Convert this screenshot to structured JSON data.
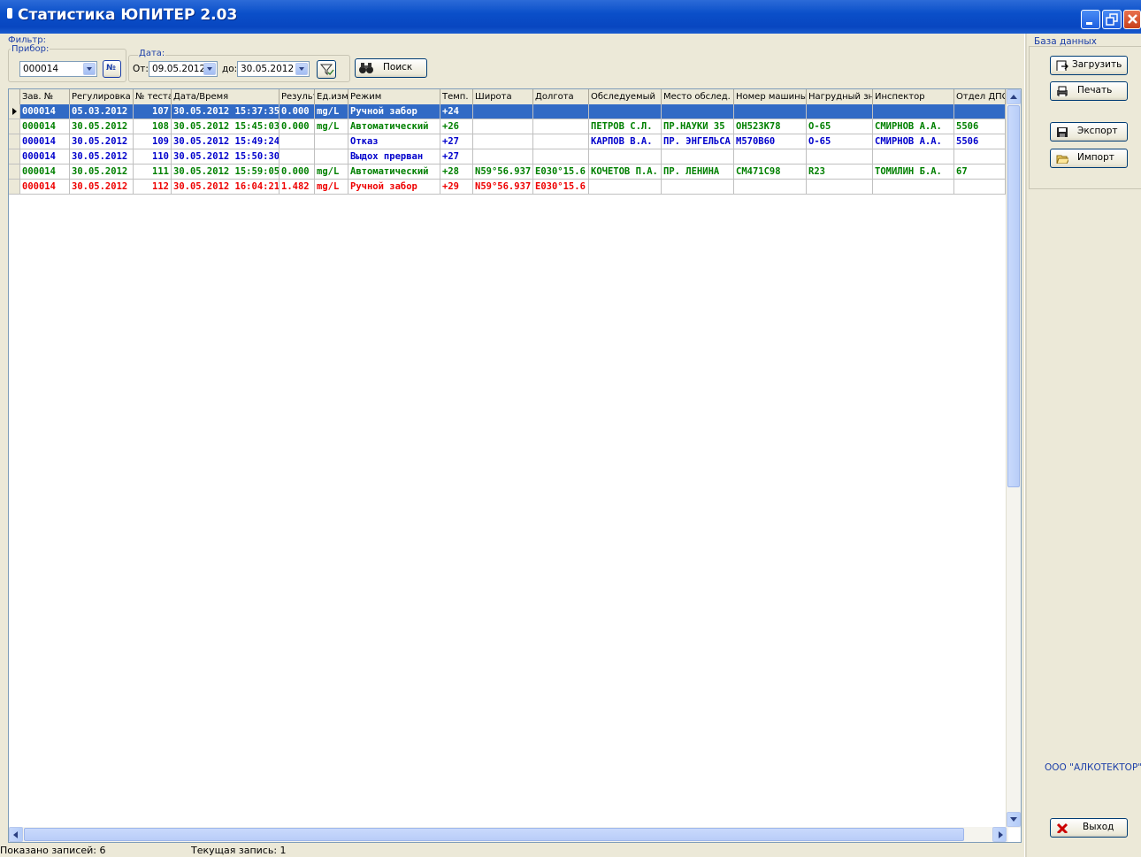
{
  "window": {
    "title": "Статистика ЮПИТЕР 2.03"
  },
  "filter": {
    "group_label": "Фильтр:",
    "device_label": "Прибор:",
    "device_value": "000014",
    "number_button": "№",
    "date_label": "Дата:",
    "from_label": "От:",
    "from_value": "09.05.2012",
    "to_label": "до:",
    "to_value": "30.05.2012",
    "search_label": "Поиск"
  },
  "table": {
    "columns": [
      "Зав. №",
      "Регулировка",
      "№ теста",
      "Дата/Время",
      "Результ",
      "Ед.изм",
      "Режим",
      "Темп.",
      "Широта",
      "Долгота",
      "Обследуемый",
      "Место обслед.",
      "Номер машины",
      "Нагрудный знак",
      "Инспектор",
      "Отдел ДПС"
    ],
    "rows": [
      {
        "color": "#ffffff",
        "cells": [
          "000014",
          "05.03.2012",
          "107",
          "30.05.2012 15:37:35",
          "0.000",
          "mg/L",
          "Ручной забор",
          "+24",
          "",
          "",
          "",
          "",
          "",
          "",
          "",
          ""
        ]
      },
      {
        "color": "#008000",
        "cells": [
          "000014",
          "30.05.2012",
          "108",
          "30.05.2012 15:45:03",
          "0.000",
          "mg/L",
          "Автоматический",
          "+26",
          "",
          "",
          "ПЕТРОВ С.Л.",
          "ПР.НАУКИ 35",
          "ОН523К78",
          "О-65",
          "СМИРНОВ А.А.",
          "5506"
        ]
      },
      {
        "color": "#0000cc",
        "cells": [
          "000014",
          "30.05.2012",
          "109",
          "30.05.2012 15:49:24",
          "",
          "",
          "Отказ",
          "+27",
          "",
          "",
          "КАРПОВ В.А.",
          "ПР. ЭНГЕЛЬСА",
          "М570В60",
          "О-65",
          "СМИРНОВ А.А.",
          "5506"
        ]
      },
      {
        "color": "#0000cc",
        "cells": [
          "000014",
          "30.05.2012",
          "110",
          "30.05.2012 15:50:30",
          "",
          "",
          "Выдох прерван",
          "+27",
          "",
          "",
          "",
          "",
          "",
          "",
          "",
          ""
        ]
      },
      {
        "color": "#008000",
        "cells": [
          "000014",
          "30.05.2012",
          "111",
          "30.05.2012 15:59:05",
          "0.000",
          "mg/L",
          "Автоматический",
          "+28",
          "N59°56.937",
          "E030°15.6",
          "КОЧЕТОВ П.А.",
          "ПР. ЛЕНИНА",
          "СМ471С98",
          "R23",
          "ТОМИЛИН Б.А.",
          "67"
        ]
      },
      {
        "color": "#ee0000",
        "cells": [
          "000014",
          "30.05.2012",
          "112",
          "30.05.2012 16:04:21",
          "1.482",
          "mg/L",
          "Ручной забор",
          "+29",
          "N59°56.937",
          "E030°15.6",
          "",
          "",
          "",
          "",
          "",
          ""
        ]
      }
    ]
  },
  "sidebar": {
    "group_label": "База данных",
    "load_label": "Загрузить",
    "print_label": "Печать",
    "export_label": "Экспорт",
    "import_label": "Импорт",
    "company": "ООО \"АЛКОТЕКТОР\"",
    "exit_label": "Выход"
  },
  "status": {
    "shown": "Показано записей: 6",
    "current": "Текущая запись: 1"
  },
  "colors": {
    "title_bar": "#0a4fc9",
    "selected_row": "#316ac5",
    "green": "#008000",
    "blue": "#0000cc",
    "red": "#ee0000"
  }
}
